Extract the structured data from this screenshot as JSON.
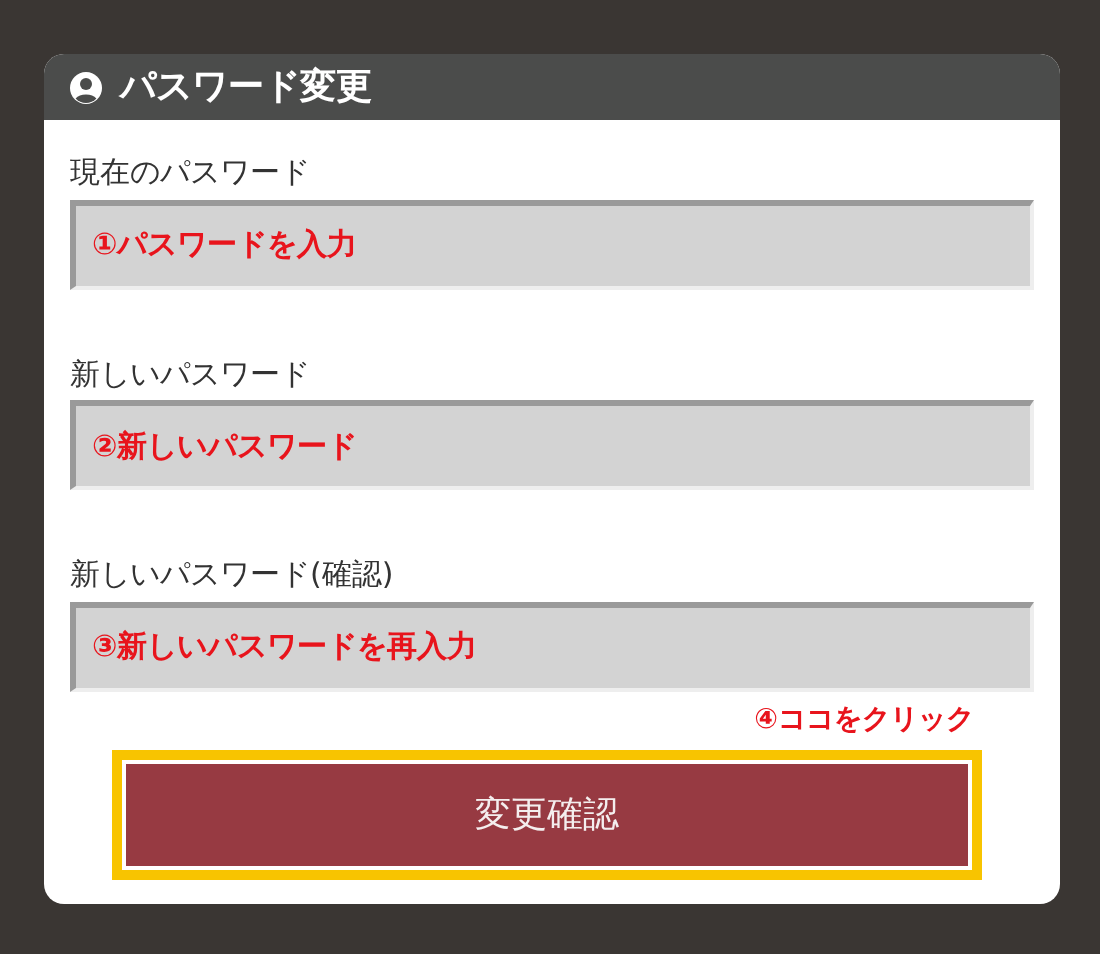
{
  "panel": {
    "title": "パスワード変更"
  },
  "fields": [
    {
      "label": "現在のパスワード",
      "value": "①パスワードを入力"
    },
    {
      "label": "新しいパスワード",
      "value": "②新しいパスワード"
    },
    {
      "label": "新しいパスワード(確認)",
      "value": "③新しいパスワードを再入力"
    }
  ],
  "hint": "④ココをクリック",
  "button": {
    "label": "変更確認",
    "highlighted": true
  }
}
